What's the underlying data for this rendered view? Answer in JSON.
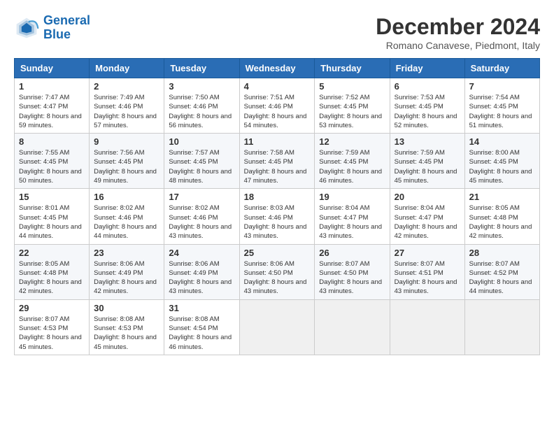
{
  "header": {
    "logo_line1": "General",
    "logo_line2": "Blue",
    "month": "December 2024",
    "location": "Romano Canavese, Piedmont, Italy"
  },
  "weekdays": [
    "Sunday",
    "Monday",
    "Tuesday",
    "Wednesday",
    "Thursday",
    "Friday",
    "Saturday"
  ],
  "weeks": [
    [
      {
        "day": "1",
        "sunrise": "7:47 AM",
        "sunset": "4:47 PM",
        "daylight": "8 hours and 59 minutes."
      },
      {
        "day": "2",
        "sunrise": "7:49 AM",
        "sunset": "4:46 PM",
        "daylight": "8 hours and 57 minutes."
      },
      {
        "day": "3",
        "sunrise": "7:50 AM",
        "sunset": "4:46 PM",
        "daylight": "8 hours and 56 minutes."
      },
      {
        "day": "4",
        "sunrise": "7:51 AM",
        "sunset": "4:46 PM",
        "daylight": "8 hours and 54 minutes."
      },
      {
        "day": "5",
        "sunrise": "7:52 AM",
        "sunset": "4:45 PM",
        "daylight": "8 hours and 53 minutes."
      },
      {
        "day": "6",
        "sunrise": "7:53 AM",
        "sunset": "4:45 PM",
        "daylight": "8 hours and 52 minutes."
      },
      {
        "day": "7",
        "sunrise": "7:54 AM",
        "sunset": "4:45 PM",
        "daylight": "8 hours and 51 minutes."
      }
    ],
    [
      {
        "day": "8",
        "sunrise": "7:55 AM",
        "sunset": "4:45 PM",
        "daylight": "8 hours and 50 minutes."
      },
      {
        "day": "9",
        "sunrise": "7:56 AM",
        "sunset": "4:45 PM",
        "daylight": "8 hours and 49 minutes."
      },
      {
        "day": "10",
        "sunrise": "7:57 AM",
        "sunset": "4:45 PM",
        "daylight": "8 hours and 48 minutes."
      },
      {
        "day": "11",
        "sunrise": "7:58 AM",
        "sunset": "4:45 PM",
        "daylight": "8 hours and 47 minutes."
      },
      {
        "day": "12",
        "sunrise": "7:59 AM",
        "sunset": "4:45 PM",
        "daylight": "8 hours and 46 minutes."
      },
      {
        "day": "13",
        "sunrise": "7:59 AM",
        "sunset": "4:45 PM",
        "daylight": "8 hours and 45 minutes."
      },
      {
        "day": "14",
        "sunrise": "8:00 AM",
        "sunset": "4:45 PM",
        "daylight": "8 hours and 45 minutes."
      }
    ],
    [
      {
        "day": "15",
        "sunrise": "8:01 AM",
        "sunset": "4:45 PM",
        "daylight": "8 hours and 44 minutes."
      },
      {
        "day": "16",
        "sunrise": "8:02 AM",
        "sunset": "4:46 PM",
        "daylight": "8 hours and 44 minutes."
      },
      {
        "day": "17",
        "sunrise": "8:02 AM",
        "sunset": "4:46 PM",
        "daylight": "8 hours and 43 minutes."
      },
      {
        "day": "18",
        "sunrise": "8:03 AM",
        "sunset": "4:46 PM",
        "daylight": "8 hours and 43 minutes."
      },
      {
        "day": "19",
        "sunrise": "8:04 AM",
        "sunset": "4:47 PM",
        "daylight": "8 hours and 43 minutes."
      },
      {
        "day": "20",
        "sunrise": "8:04 AM",
        "sunset": "4:47 PM",
        "daylight": "8 hours and 42 minutes."
      },
      {
        "day": "21",
        "sunrise": "8:05 AM",
        "sunset": "4:48 PM",
        "daylight": "8 hours and 42 minutes."
      }
    ],
    [
      {
        "day": "22",
        "sunrise": "8:05 AM",
        "sunset": "4:48 PM",
        "daylight": "8 hours and 42 minutes."
      },
      {
        "day": "23",
        "sunrise": "8:06 AM",
        "sunset": "4:49 PM",
        "daylight": "8 hours and 42 minutes."
      },
      {
        "day": "24",
        "sunrise": "8:06 AM",
        "sunset": "4:49 PM",
        "daylight": "8 hours and 43 minutes."
      },
      {
        "day": "25",
        "sunrise": "8:06 AM",
        "sunset": "4:50 PM",
        "daylight": "8 hours and 43 minutes."
      },
      {
        "day": "26",
        "sunrise": "8:07 AM",
        "sunset": "4:50 PM",
        "daylight": "8 hours and 43 minutes."
      },
      {
        "day": "27",
        "sunrise": "8:07 AM",
        "sunset": "4:51 PM",
        "daylight": "8 hours and 43 minutes."
      },
      {
        "day": "28",
        "sunrise": "8:07 AM",
        "sunset": "4:52 PM",
        "daylight": "8 hours and 44 minutes."
      }
    ],
    [
      {
        "day": "29",
        "sunrise": "8:07 AM",
        "sunset": "4:53 PM",
        "daylight": "8 hours and 45 minutes."
      },
      {
        "day": "30",
        "sunrise": "8:08 AM",
        "sunset": "4:53 PM",
        "daylight": "8 hours and 45 minutes."
      },
      {
        "day": "31",
        "sunrise": "8:08 AM",
        "sunset": "4:54 PM",
        "daylight": "8 hours and 46 minutes."
      },
      null,
      null,
      null,
      null
    ]
  ]
}
